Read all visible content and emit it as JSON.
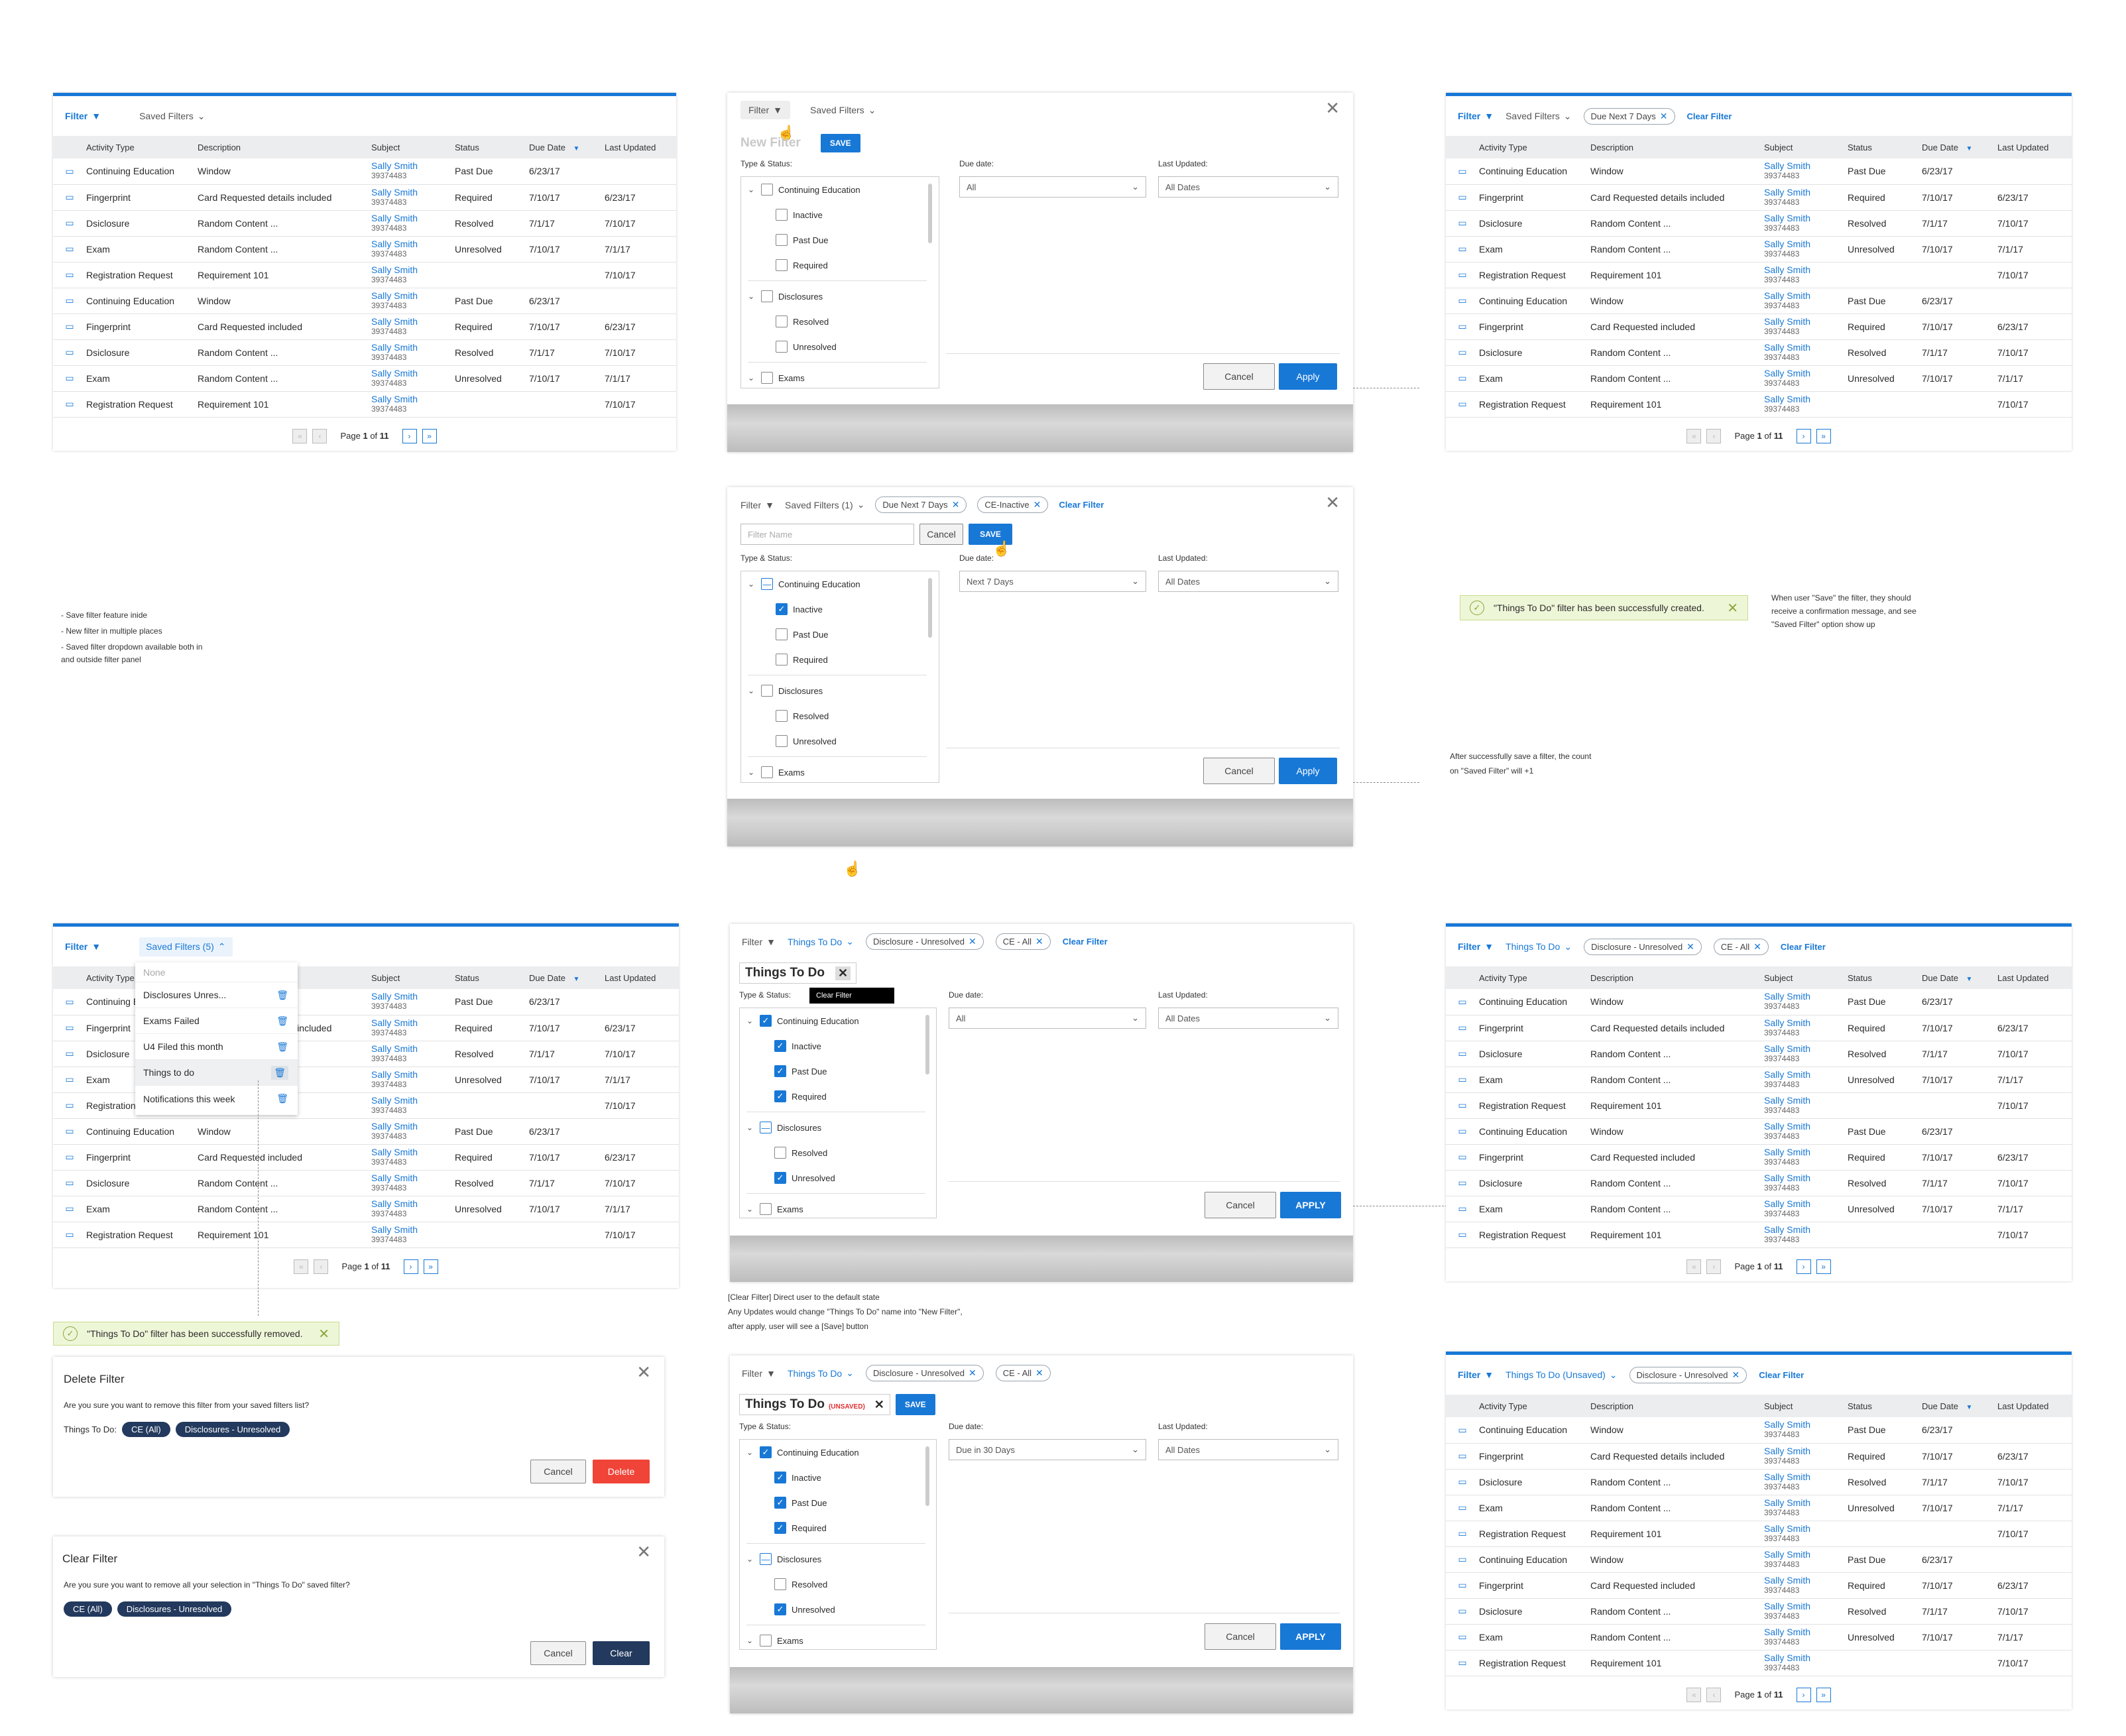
{
  "filter": "Filter",
  "saved_filters": "Saved Filters",
  "saved_filters_1": "Saved Filters (1)",
  "saved_filters_5": "Saved Filters (5)",
  "things_to_do": "Things To Do",
  "things_to_do_unsaved": "Things To Do (Unsaved)",
  "clear_filter": "Clear Filter",
  "new_filter": "New Filter",
  "save": "SAVE",
  "cancel": "Cancel",
  "apply": "Apply",
  "apply_caps": "APPLY",
  "filter_name_ph": "Filter Name",
  "type_status": "Type & Status:",
  "due_date": "Due date:",
  "last_updated": "Last Updated:",
  "all": "All",
  "all_dates": "All Dates",
  "next_7_days": "Next 7 Days",
  "due_in_30": "Due in 30 Days",
  "chips": {
    "due_next7": "Due Next 7 Days",
    "ce_inactive": "CE-Inactive",
    "disc_unres": "Disclosure - Unresolved",
    "ce_all": "CE - All"
  },
  "tree": {
    "ce": "Continuing Education",
    "inactive": "Inactive",
    "past_due": "Past Due",
    "required": "Required",
    "disc": "Disclosures",
    "resolved": "Resolved",
    "unresolved": "Unresolved",
    "exams": "Exams"
  },
  "columns": [
    "Activity Type",
    "Description",
    "Subject",
    "Status",
    "Due Date",
    "Last Updated"
  ],
  "rows": [
    {
      "type": "Continuing Education",
      "desc": "Window",
      "name": "Sally Smith",
      "id": "39374483",
      "status": "Past Due",
      "due": "6/23/17",
      "upd": ""
    },
    {
      "type": "Fingerprint",
      "desc": "Card Requested details included",
      "name": "Sally Smith",
      "id": "39374483",
      "status": "Required",
      "due": "7/10/17",
      "upd": "6/23/17"
    },
    {
      "type": "Dsiclosure",
      "desc": "Random Content ...",
      "name": "Sally Smith",
      "id": "39374483",
      "status": "Resolved",
      "due": "7/1/17",
      "upd": "7/10/17"
    },
    {
      "type": "Exam",
      "desc": "Random Content ...",
      "name": "Sally Smith",
      "id": "39374483",
      "status": "Unresolved",
      "due": "7/10/17",
      "upd": "7/1/17"
    },
    {
      "type": "Registration Request",
      "desc": "Requirement 101",
      "name": "Sally Smith",
      "id": "39374483",
      "status": "",
      "due": "",
      "upd": "7/10/17"
    },
    {
      "type": "Continuing Education",
      "desc": "Window",
      "name": "Sally Smith",
      "id": "39374483",
      "status": "Past Due",
      "due": "6/23/17",
      "upd": ""
    },
    {
      "type": "Fingerprint",
      "desc": "Card Requested included",
      "name": "Sally Smith",
      "id": "39374483",
      "status": "Required",
      "due": "7/10/17",
      "upd": "6/23/17"
    },
    {
      "type": "Dsiclosure",
      "desc": "Random Content ...",
      "name": "Sally Smith",
      "id": "39374483",
      "status": "Resolved",
      "due": "7/1/17",
      "upd": "7/10/17"
    },
    {
      "type": "Exam",
      "desc": "Random Content ...",
      "name": "Sally Smith",
      "id": "39374483",
      "status": "Unresolved",
      "due": "7/10/17",
      "upd": "7/1/17"
    },
    {
      "type": "Registration Request",
      "desc": "Requirement 101",
      "name": "Sally Smith",
      "id": "39374483",
      "status": "",
      "due": "",
      "upd": "7/10/17"
    }
  ],
  "pager": {
    "prefix": "Page",
    "current": "1",
    "of": "of",
    "total": "11"
  },
  "dropdown": [
    "None",
    "Disclosures Unres...",
    "Exams Failed",
    "U4 Filed this month",
    "Things to do",
    "Notifications this week"
  ],
  "toast_created": "\"Things To Do\" filter has been successfully created.",
  "toast_removed": "\"Things To Do\" filter has been successfully removed.",
  "tooltip": "Clear Filter",
  "unsaved": "(UNSAVED)",
  "delete_dialog": {
    "title": "Delete Filter",
    "msg": "Are you sure you want to remove this filter from your saved filters list?",
    "label": "Things To Do:",
    "pill1": "CE (All)",
    "pill2": "Disclosures - Unresolved",
    "cancel": "Cancel",
    "delete": "Delete"
  },
  "clear_dialog": {
    "title": "Clear Filter",
    "msg": "Are you sure you want to remove all your selection in \"Things To Do\" saved filter?",
    "pill1": "CE (All)",
    "pill2": "Disclosures - Unresolved",
    "cancel": "Cancel",
    "clear": "Clear"
  },
  "notes": {
    "left1": "- Save filter feature inide",
    "left2": "- New filter in multiple places",
    "left3": "- Saved filter dropdown available both in",
    "left4": "and outside filter panel",
    "right1": "When user \"Save\" the filter, they should",
    "right2": "receive a confirmation message, and see",
    "right3": "\"Saved Filter\" option show up",
    "count1": "After successfully save a filter, the count",
    "count2": "on \"Saved Filter\" will +1",
    "cf1": "[Clear Filter] Direct user to the default state",
    "cf2": "Any Updates would change \"Things To Do\" name into \"New Filter\",",
    "cf3": "after apply, user will see a [Save] button"
  },
  "colors": {
    "accent": "#1878d6",
    "danger": "#f04438",
    "navy": "#23395d",
    "success_bg": "#eef6d8"
  }
}
